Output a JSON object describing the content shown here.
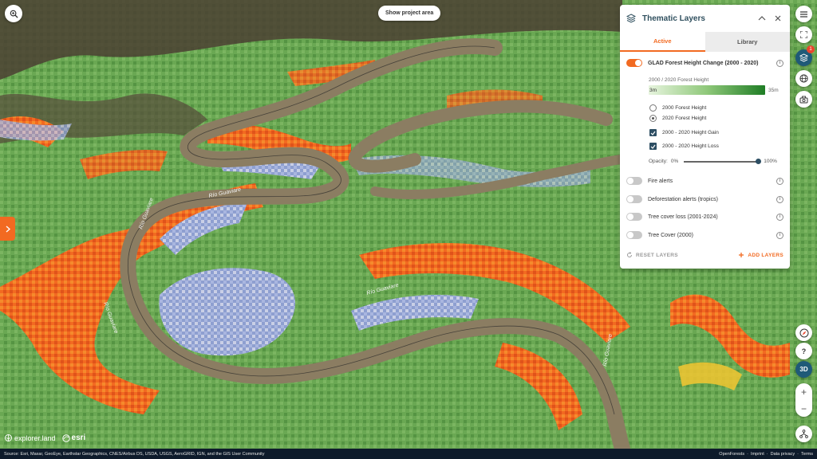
{
  "map": {
    "river_labels": [
      "Río Guaviare",
      "Río Guaviare",
      "Río Guaviare",
      "Río Guaviare",
      "Río Guaviare"
    ],
    "colors": {
      "low_vegetation": "#5e9b4a",
      "gain": "#f26a21",
      "loss": "#8fa0d2",
      "river": "#8b7d62"
    }
  },
  "top": {
    "zoom_icon": "zoom-to-icon",
    "project_area_label": "Show project area",
    "side_toggle_icon": "chevron-right-icon"
  },
  "panel": {
    "title": "Thematic Layers",
    "tabs": [
      {
        "label": "Active"
      },
      {
        "label": "Library"
      }
    ],
    "active_layer": {
      "name": "GLAD Forest Height Change (2000 - 2020)",
      "legend_title": "2000 / 2020 Forest Height",
      "legend_min": "3m",
      "legend_max": "35m",
      "options": [
        {
          "label": "2000 Forest Height",
          "type": "radio",
          "checked": false
        },
        {
          "label": "2020 Forest Height",
          "type": "radio",
          "checked": true
        },
        {
          "label": "2000 - 2020 Height Gain",
          "type": "checkbox",
          "checked": true
        },
        {
          "label": "2000 - 2020 Height Loss",
          "type": "checkbox",
          "checked": true
        }
      ],
      "opacity_label": "Opacity:",
      "opacity_min": "0%",
      "opacity_max": "100%",
      "opacity_value": 1.0
    },
    "other_layers": [
      {
        "name": "Fire alerts",
        "on": false
      },
      {
        "name": "Deforestation alerts (tropics)",
        "on": false
      },
      {
        "name": "Tree cover loss (2001-2024)",
        "on": false
      },
      {
        "name": "Tree Cover (2000)",
        "on": false
      }
    ],
    "reset_label": "RESET LAYERS",
    "add_label": "ADD LAYERS",
    "accent_color": "#f26a21"
  },
  "rail": {
    "items": [
      "menu-icon",
      "fullscreen-icon",
      "layers-icon",
      "globe-icon",
      "screenshot-icon",
      "compass-icon",
      "help-icon"
    ],
    "layers_badge": "1",
    "view_mode_label": "3D",
    "zoom_in": "+",
    "zoom_out": "−"
  },
  "footer": {
    "logo_explorer": "explorer.land",
    "logo_esri": "esri",
    "attribution": "Source: Esri, Maxar, GeoEye, Earthstar Geographics, CNES/Airbus DS, USDA, USGS, AeroGRID, IGN, and the GIS User Community",
    "links": [
      "OpenForests",
      "·",
      "Imprint",
      "·",
      "Data privacy",
      "·",
      "Terms"
    ]
  }
}
